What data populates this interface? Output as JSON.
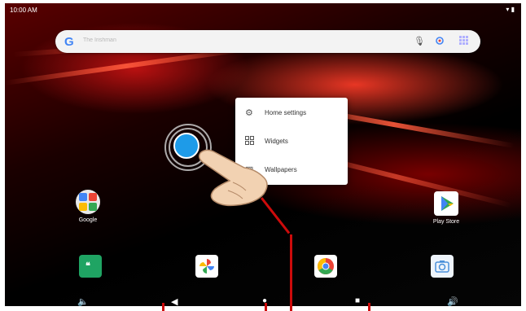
{
  "status_bar": {
    "time": "10:00 AM",
    "icons": [
      "wifi-icon",
      "battery-icon"
    ]
  },
  "search": {
    "logo": "G",
    "placeholder": "The Irishman",
    "icons": [
      "mic-icon",
      "lens-icon",
      "apps-grid-icon"
    ]
  },
  "context_menu": {
    "items": [
      {
        "label": "Home settings",
        "icon": "gear-icon"
      },
      {
        "label": "Widgets",
        "icon": "widgets-icon"
      },
      {
        "label": "Wallpapers",
        "icon": "wallpaper-icon"
      }
    ]
  },
  "apps": [
    {
      "label": "Google",
      "icon": "google-folder-icon"
    },
    {
      "label": "Play Store",
      "icon": "play-store-icon"
    }
  ],
  "dock": [
    "hangouts-icon",
    "photos-icon",
    "chrome-icon",
    "camera-icon"
  ],
  "nav_bar": [
    "volume-down-icon",
    "back-icon",
    "home-icon",
    "recents-icon",
    "volume-up-icon"
  ],
  "colors": {
    "accent_blue": "#1e9be8",
    "callout_red": "#cc0b0b",
    "menu_bg": "#ffffff"
  }
}
